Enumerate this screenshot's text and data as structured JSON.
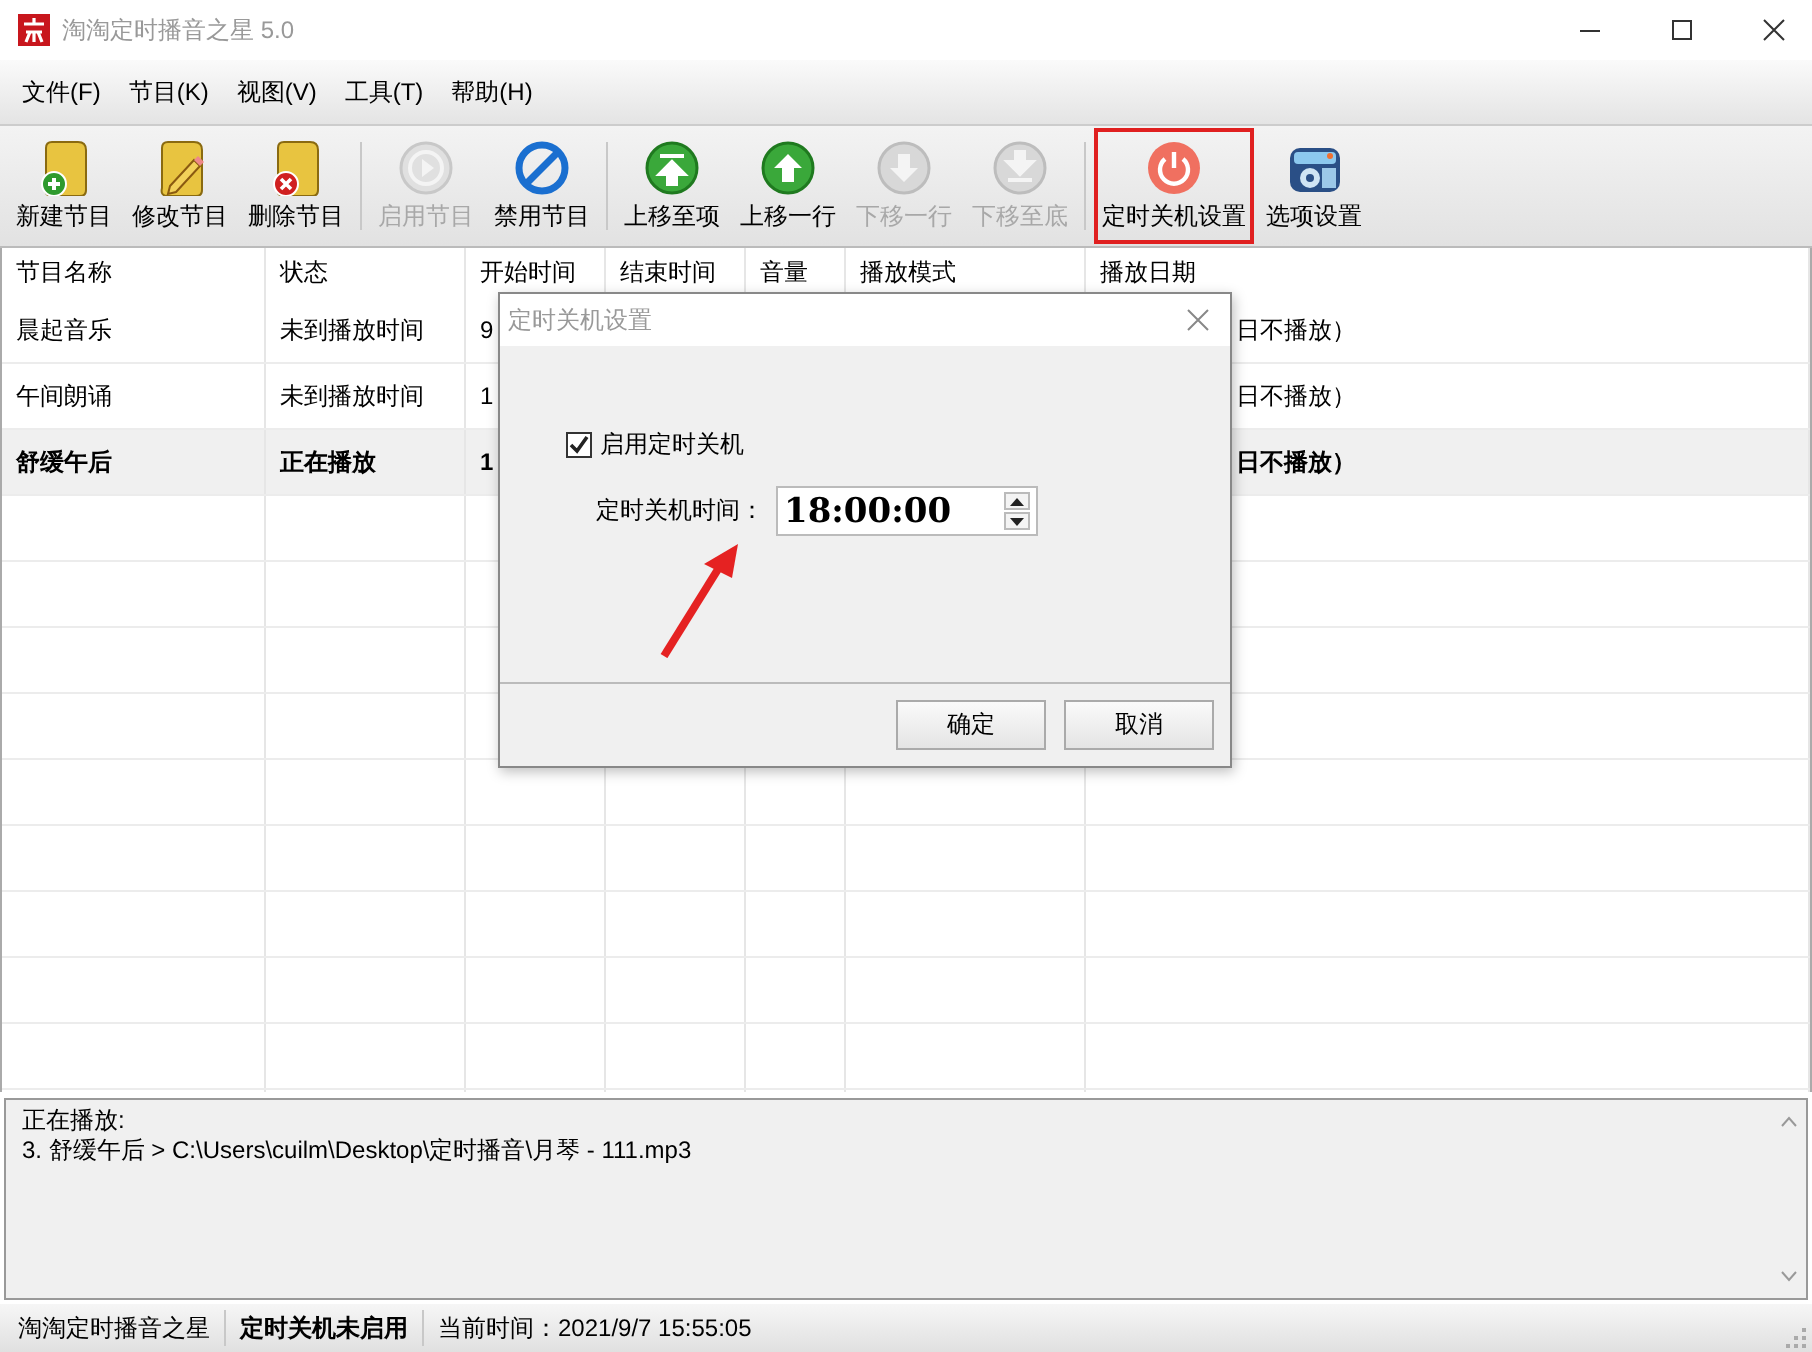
{
  "window": {
    "title": "淘淘定时播音之星 5.0"
  },
  "menu": [
    "文件(F)",
    "节目(K)",
    "视图(V)",
    "工具(T)",
    "帮助(H)"
  ],
  "toolbar": [
    {
      "kind": "button",
      "label": "新建节目",
      "disabled": false,
      "highlighted": false
    },
    {
      "kind": "button",
      "label": "修改节目",
      "disabled": false,
      "highlighted": false
    },
    {
      "kind": "button",
      "label": "删除节目",
      "disabled": false,
      "highlighted": false
    },
    {
      "kind": "separator"
    },
    {
      "kind": "button",
      "label": "启用节目",
      "disabled": true,
      "highlighted": false
    },
    {
      "kind": "button",
      "label": "禁用节目",
      "disabled": false,
      "highlighted": false
    },
    {
      "kind": "separator"
    },
    {
      "kind": "button",
      "label": "上移至项",
      "disabled": false,
      "highlighted": false
    },
    {
      "kind": "button",
      "label": "上移一行",
      "disabled": false,
      "highlighted": false
    },
    {
      "kind": "button",
      "label": "下移一行",
      "disabled": true,
      "highlighted": false
    },
    {
      "kind": "button",
      "label": "下移至底",
      "disabled": true,
      "highlighted": false
    },
    {
      "kind": "separator"
    },
    {
      "kind": "button",
      "label": "定时关机设置",
      "disabled": false,
      "highlighted": true
    },
    {
      "kind": "button",
      "label": "选项设置",
      "disabled": false,
      "highlighted": false
    }
  ],
  "table": {
    "columns": [
      "节目名称",
      "状态",
      "开始时间",
      "结束时间",
      "音量",
      "播放模式",
      "播放日期"
    ],
    "rows": [
      {
        "name": "晨起音乐",
        "status": "未到播放时间",
        "start": "9",
        "date": "日不播放）",
        "playing": false
      },
      {
        "name": "午间朗诵",
        "status": "未到播放时间",
        "start": "1",
        "date": "日不播放）",
        "playing": false
      },
      {
        "name": "舒缓午后",
        "status": "正在播放",
        "start": "1",
        "date": "日不播放）",
        "playing": true
      }
    ]
  },
  "now_playing": [
    "正在播放:",
    "3. 舒缓午后 > C:\\Users\\cuilm\\Desktop\\定时播音\\月琴 - 111.mp3"
  ],
  "status_bar": [
    {
      "text": "淘淘定时播音之星",
      "bold": false
    },
    {
      "text": "定时关机未启用",
      "bold": true
    },
    {
      "text": "当前时间：2021/9/7 15:55:05",
      "bold": false
    }
  ],
  "dialog": {
    "title": "定时关机设置",
    "checkbox": {
      "label": "启用定时关机",
      "checked": true
    },
    "time_label": "定时关机时间：",
    "time_value": "18:00:00",
    "buttons": [
      "确定",
      "取消"
    ]
  }
}
